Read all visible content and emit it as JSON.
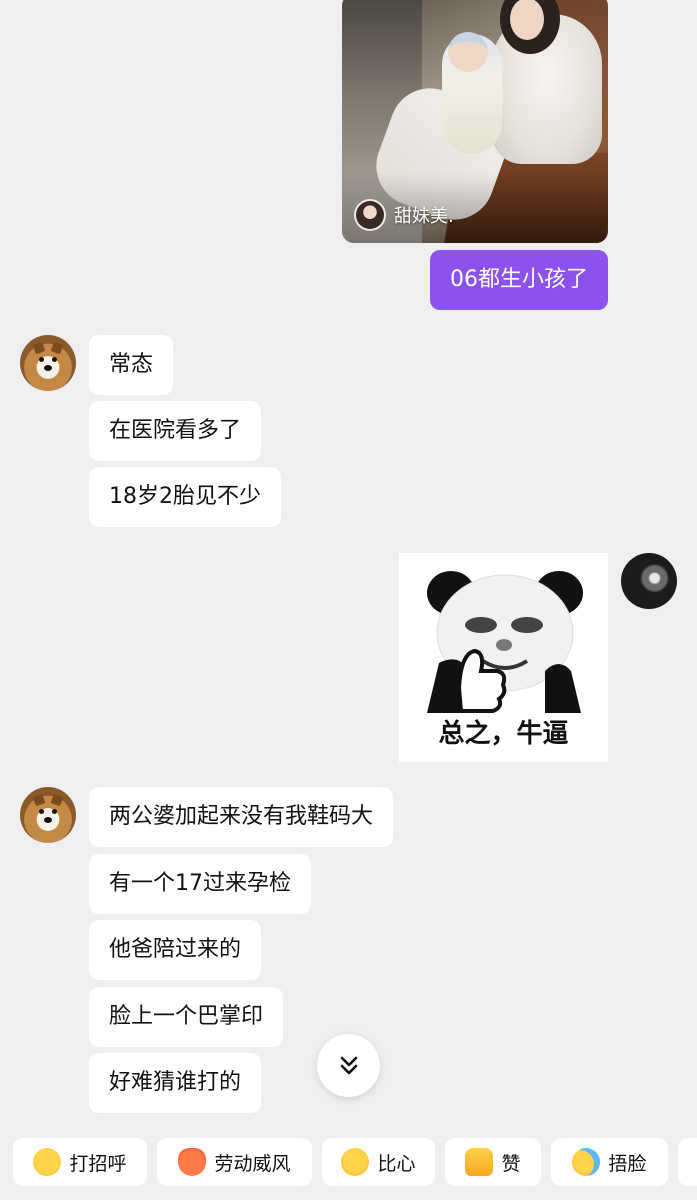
{
  "shared_post": {
    "author_name": "甜妹美."
  },
  "messages": {
    "sent_1": "06都生小孩了",
    "recv_group_1": [
      "常态",
      "在医院看多了",
      "18岁2胎见不少"
    ],
    "sticker_caption": "总之，牛逼",
    "recv_group_2": [
      "两公婆加起来没有我鞋码大",
      "有一个17过来孕检",
      "他爸陪过来的",
      "脸上一个巴掌印",
      "好难猜谁打的"
    ]
  },
  "quick_replies": [
    {
      "label": "打招呼",
      "icon": "smiling-face-icon"
    },
    {
      "label": "劳动威风",
      "icon": "crab-icon"
    },
    {
      "label": "比心",
      "icon": "heart-hands-icon"
    },
    {
      "label": "赞",
      "icon": "thumbs-up-icon"
    },
    {
      "label": "捂脸",
      "icon": "facepalm-laugh-icon"
    }
  ],
  "colors": {
    "background": "#efeff1",
    "sent_bubble": "#8b52ee",
    "received_bubble": "#ffffff"
  }
}
